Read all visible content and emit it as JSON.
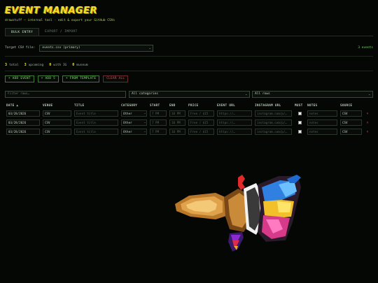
{
  "app": {
    "title": "EVENT MANAGER",
    "subtitle": "drawstuff — internal tool · edit & export your GitHub CSVs"
  },
  "tabs": [
    {
      "label": "BULK ENTRY",
      "active": true
    },
    {
      "label": "EXPORT / IMPORT",
      "active": false
    }
  ],
  "target": {
    "label": "Target CSV file:",
    "selected": "events.csv (primary)",
    "events_count": "3 events"
  },
  "stats": [
    {
      "num": "3",
      "label": "total"
    },
    {
      "num": "3",
      "label": "upcoming"
    },
    {
      "num": "0",
      "label": "with IG"
    },
    {
      "num": "0",
      "label": "museum"
    }
  ],
  "actions": {
    "add_event": "+ ADD EVENT",
    "add_5": "+ ADD 5",
    "from_template": "+ FROM TEMPLATE",
    "clear_all": "CLEAR ALL"
  },
  "filters": {
    "search_placeholder": "Filter rows…",
    "category": "All categories",
    "rows": "All rows"
  },
  "table": {
    "columns": [
      "DATE ▲",
      "VENUE",
      "TITLE",
      "CATEGORY",
      "START",
      "END",
      "PRICE",
      "EVENT URL",
      "INSTAGRAM URL",
      "MUST",
      "NOTES",
      "SOURCE"
    ],
    "rows": [
      {
        "date": "03/28/2026",
        "venue": "CSV",
        "title": "Event title",
        "category": "Other",
        "start": "7 PM",
        "end": "10 PM",
        "price": "Free / $15",
        "event_url": "https://…",
        "instagram_url": "instagram.com/p/…",
        "notes": "notes",
        "source": "CSV"
      },
      {
        "date": "03/28/2026",
        "venue": "CSV",
        "title": "Event title",
        "category": "Other",
        "start": "7 PM",
        "end": "10 PM",
        "price": "Free / $15",
        "event_url": "https://…",
        "instagram_url": "instagram.com/p/…",
        "notes": "notes",
        "source": "CSV"
      },
      {
        "date": "03/28/2026",
        "venue": "CSV",
        "title": "Event title",
        "category": "Other",
        "start": "7 PM",
        "end": "10 PM",
        "price": "Free / $15",
        "event_url": "https://…",
        "instagram_url": "instagram.com/p/…",
        "notes": "notes",
        "source": "CSV"
      }
    ],
    "delete_symbol": "×"
  },
  "colors": {
    "accent": "#6ddc5e",
    "title": "#f0e02a",
    "danger": "#c74545",
    "background": "#050705"
  }
}
